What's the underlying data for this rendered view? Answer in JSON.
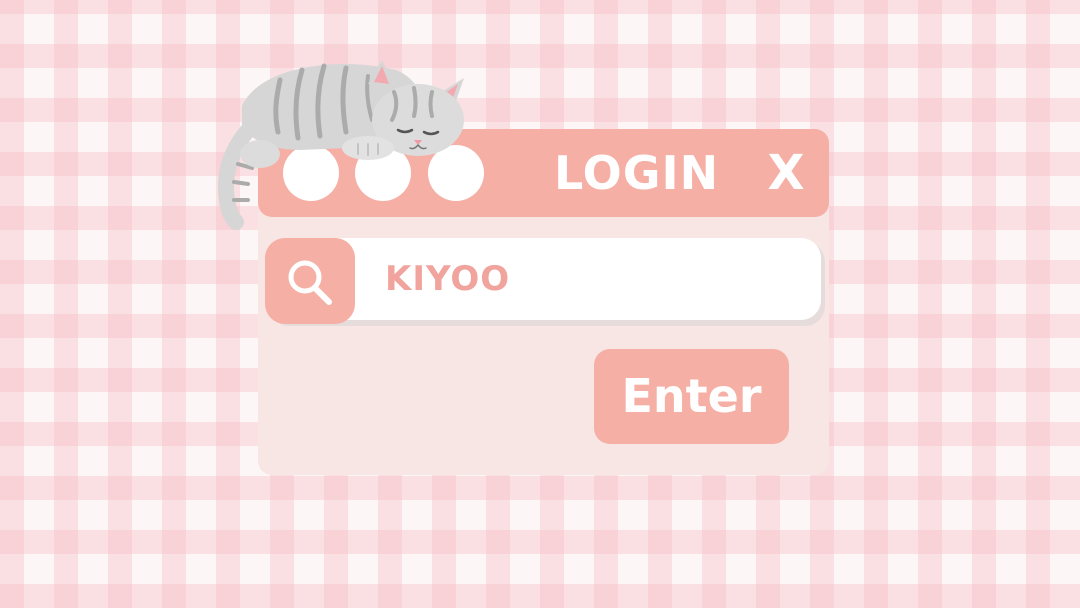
{
  "window": {
    "title": "LOGIN",
    "close_label": "X"
  },
  "search": {
    "value": "KIYOO",
    "icon": "search-icon"
  },
  "actions": {
    "enter_label": "Enter"
  },
  "decoration": {
    "mascot": "sleeping-tabby-cat"
  },
  "colors": {
    "accent": "#f5afa5",
    "panel": "#f7e6e4",
    "field": "#ffffff",
    "input_text": "#f0a49d",
    "gingham": "#f4bcc4"
  }
}
